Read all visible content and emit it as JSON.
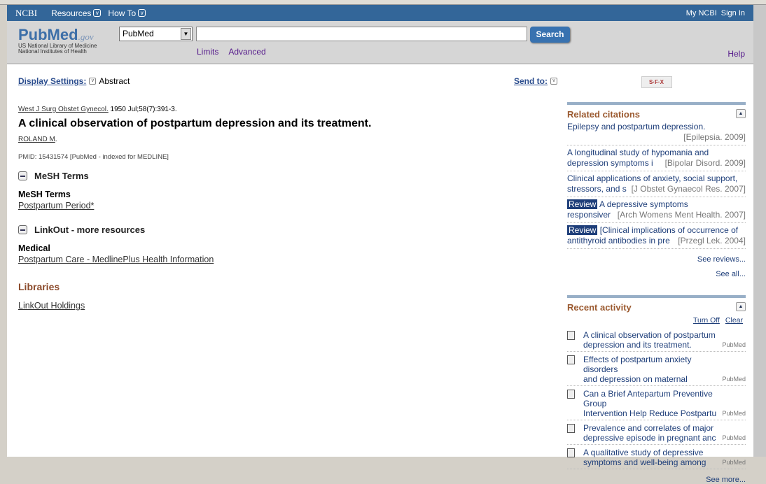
{
  "nav": {
    "logo": "NCBI",
    "resources": "Resources",
    "howto": "How To",
    "myncbi": "My NCBI",
    "signin": "Sign In"
  },
  "header": {
    "logo": "PubMed",
    "logo_gov": ".gov",
    "org1": "US National Library of Medicine",
    "org2": "National Institutes of Health",
    "db": "PubMed",
    "search_value": "",
    "search_button": "Search",
    "limits": "Limits",
    "advanced": "Advanced",
    "help": "Help"
  },
  "main": {
    "display_settings": "Display Settings:",
    "format": "Abstract",
    "send_to": "Send to:",
    "journal": "West J Surg Obstet Gynecol.",
    "citation": " 1950 Jul;58(7):391-3.",
    "title": "A clinical observation of postpartum depression and its treatment.",
    "author": "ROLAND M",
    "pmid": "PMID: 15431574 [PubMed - indexed for MEDLINE]",
    "mesh_header": "MeSH Terms",
    "mesh_sub": "MeSH Terms",
    "mesh_term": "Postpartum Period*",
    "linkout_header": "LinkOut - more resources",
    "linkout_sub": "Medical",
    "linkout_link": "Postpartum Care - MedlinePlus Health Information",
    "libraries": "Libraries",
    "holdings": "LinkOut Holdings"
  },
  "sidebar": {
    "sfx": "S·F·X",
    "related_title": "Related citations",
    "related": [
      {
        "review": "",
        "l1": "Epilepsy and postpartum depression.",
        "l2": "",
        "src": "[Epilepsia. 2009]"
      },
      {
        "review": "",
        "l1": "A longitudinal study of hypomania and",
        "l2": "depression symptoms i",
        "src": "[Bipolar Disord. 2009]"
      },
      {
        "review": "",
        "l1": "Clinical applications of anxiety, social support,",
        "l2": "stressors, and s",
        "src": "[J Obstet Gynaecol Res. 2007]"
      },
      {
        "review": "Review",
        "l1": "A depressive symptoms",
        "l2": "responsiver",
        "src": "[Arch Womens Ment Health. 2007]"
      },
      {
        "review": "Review",
        "l1": "[Clinical implications of occurrence of",
        "l2": "antithyroid antibodies in pre",
        "src": "[Przegl Lek. 2004]"
      }
    ],
    "see_reviews": "See reviews...",
    "see_all": "See all...",
    "recent_title": "Recent activity",
    "turn_off": "Turn Off",
    "clear": "Clear",
    "recent": [
      {
        "l1": "A clinical observation of postpartum",
        "l2": "depression and its treatment.",
        "src": "PubMed"
      },
      {
        "l1": "Effects of postpartum anxiety disorders",
        "l2": "and depression on maternal",
        "src": "PubMed"
      },
      {
        "l1": "Can a Brief Antepartum Preventive Group",
        "l2": "Intervention Help Reduce Postpartu",
        "src": "PubMed"
      },
      {
        "l1": "Prevalence and correlates of major",
        "l2": "depressive episode in pregnant anc",
        "src": "PubMed"
      },
      {
        "l1": "A qualitative study of depressive",
        "l2": "symptoms and well-being among",
        "src": "PubMed"
      }
    ],
    "see_more": "See more..."
  }
}
